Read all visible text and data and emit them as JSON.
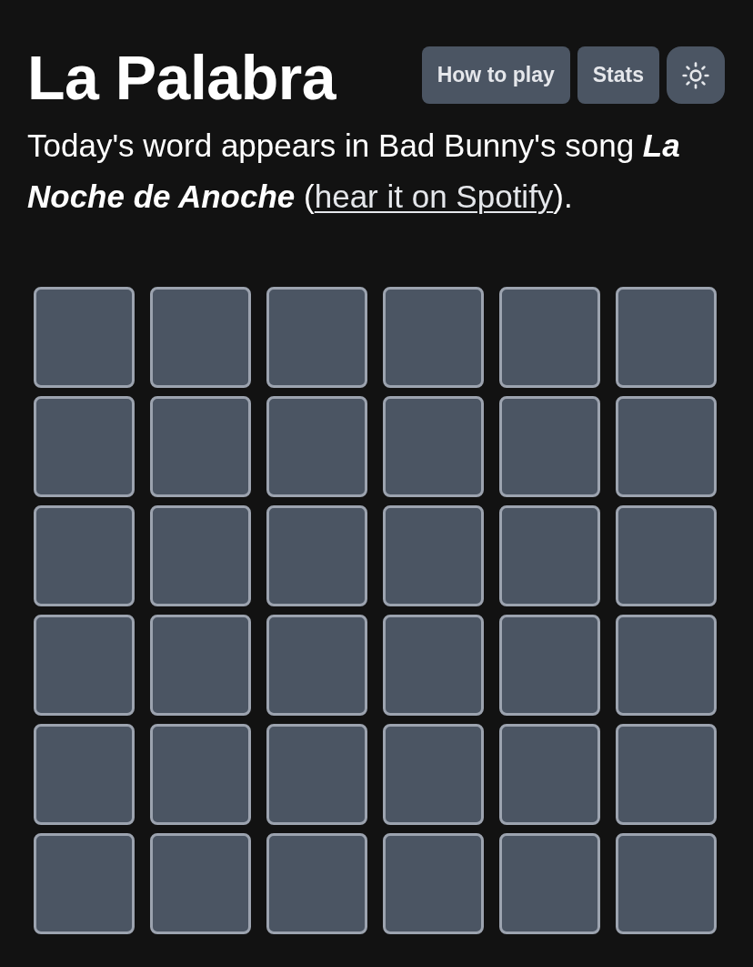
{
  "header": {
    "title": "La Palabra",
    "buttons": [
      {
        "kind": "text",
        "label": "How to play"
      },
      {
        "kind": "text",
        "label": "Stats"
      },
      {
        "kind": "theme"
      }
    ]
  },
  "description": {
    "text": "Today's word appears in Bad Bunny's song *La Noche de Anoche* (",
    "link": "hear it on Spotify",
    "end": ")."
  },
  "board": {
    "rows": [
      {
        "tiles": [
          {
            "kind": "empty"
          },
          {
            "kind": "empty"
          },
          {
            "kind": "empty"
          },
          {
            "kind": "empty"
          },
          {
            "kind": "empty"
          },
          {
            "kind": "empty"
          }
        ]
      },
      {
        "tiles": [
          {
            "kind": "empty"
          },
          {
            "kind": "empty"
          },
          {
            "kind": "empty"
          },
          {
            "kind": "empty"
          },
          {
            "kind": "empty"
          },
          {
            "kind": "empty"
          }
        ]
      },
      {
        "tiles": [
          {
            "kind": "empty"
          },
          {
            "kind": "empty"
          },
          {
            "kind": "empty"
          },
          {
            "kind": "empty"
          },
          {
            "kind": "empty"
          },
          {
            "kind": "empty"
          }
        ]
      },
      {
        "tiles": [
          {
            "kind": "empty"
          },
          {
            "kind": "empty"
          },
          {
            "kind": "empty"
          },
          {
            "kind": "empty"
          },
          {
            "kind": "empty"
          },
          {
            "kind": "empty"
          }
        ]
      },
      {
        "tiles": [
          {
            "kind": "empty"
          },
          {
            "kind": "empty"
          },
          {
            "kind": "empty"
          },
          {
            "kind": "empty"
          },
          {
            "kind": "empty"
          },
          {
            "kind": "empty"
          }
        ]
      },
      {
        "tiles": [
          {
            "kind": "empty"
          },
          {
            "kind": "empty"
          },
          {
            "kind": "empty"
          },
          {
            "kind": "empty"
          },
          {
            "kind": "empty"
          },
          {
            "kind": "empty"
          }
        ]
      }
    ]
  }
}
